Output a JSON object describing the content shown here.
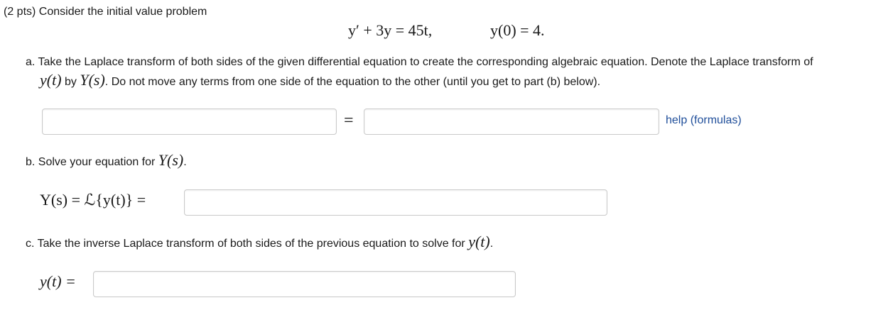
{
  "problem": {
    "intro": "(2 pts) Consider the initial value problem",
    "ode": "y′ + 3y = 45t,",
    "initial_condition": "y(0) = 4."
  },
  "part_a": {
    "text_line1": "a. Take the Laplace transform of both sides of the given differential equation to create the corresponding algebraic equation. Denote the Laplace transform of",
    "math_y": "y(t)",
    "by_word": "by",
    "math_Y": "Y(s)",
    "text_line2_rest": ". Do not move any terms from one side of the equation to the other (until you get to part (b) below).",
    "equals": "=",
    "left_value": "",
    "right_value": "",
    "help_link": "help (formulas)"
  },
  "part_b": {
    "text": "b. Solve your equation for",
    "math_Y": "Y(s)",
    "text_end": ".",
    "lhs": "Y(s) = ℒ{y(t)} =",
    "answer_value": ""
  },
  "part_c": {
    "text": "c. Take the inverse Laplace transform of both sides of the previous equation to solve for",
    "math_y": "y(t)",
    "text_end": ".",
    "lhs": "y(t) =",
    "answer_value": ""
  }
}
